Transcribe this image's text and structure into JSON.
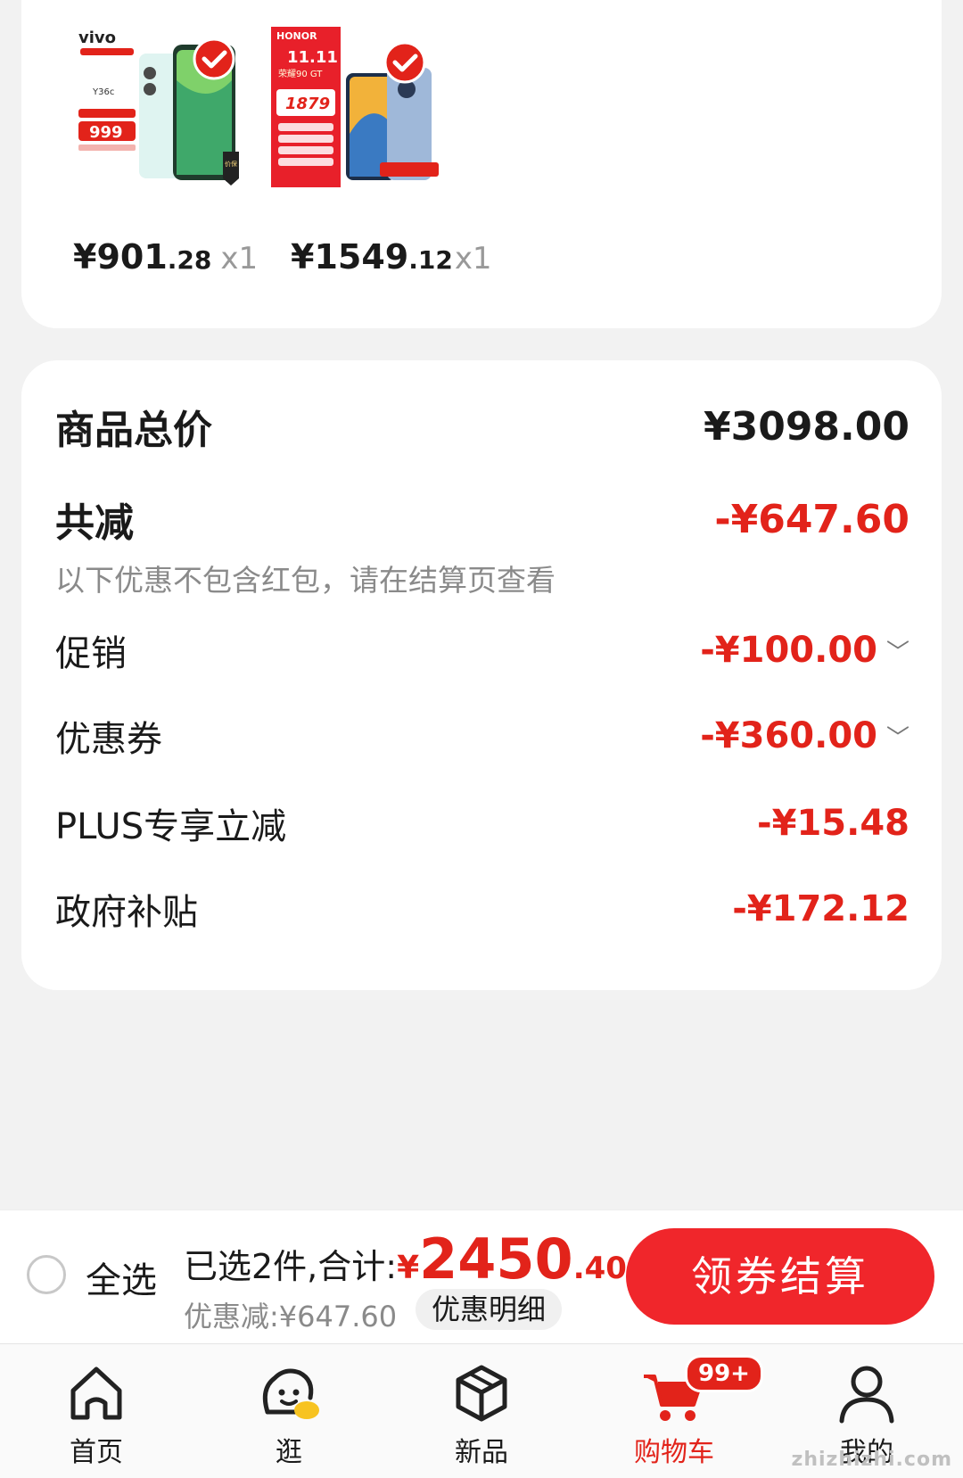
{
  "products": [
    {
      "brand": "vivo",
      "model": "Y36c",
      "promo_price": "999",
      "badge": "价保 11.11",
      "price_int": "¥901",
      "price_dec": ".28",
      "qty": "x1"
    },
    {
      "brand": "HONOR",
      "model": "荣耀90 GT",
      "event": "11.11",
      "promo_price": "1879",
      "price_int": "¥1549",
      "price_dec": ".12",
      "qty": "x1"
    }
  ],
  "summary": {
    "total_label": "商品总价",
    "total_value": "¥3098.00",
    "reduce_label": "共减",
    "reduce_value": "-¥647.60",
    "reduce_note": "以下优惠不包含红包，请在结算页查看",
    "items": [
      {
        "label": "促销",
        "value": "-¥100.00",
        "expandable": true
      },
      {
        "label": "优惠券",
        "value": "-¥360.00",
        "expandable": true
      },
      {
        "label": "PLUS专享立减",
        "value": "-¥15.48",
        "expandable": false
      },
      {
        "label": "政府补贴",
        "value": "-¥172.12",
        "expandable": false
      }
    ]
  },
  "checkout": {
    "select_all": "全选",
    "selected_text": "已选2件,合计:",
    "currency": "¥",
    "total_int": "2450",
    "total_dec": ".40",
    "discount_text": "优惠减:¥647.60",
    "detail_button": "优惠明细",
    "checkout_button": "领券结算"
  },
  "tabs": [
    {
      "label": "首页",
      "icon": "home-icon",
      "active": false
    },
    {
      "label": "逛",
      "icon": "browse-icon",
      "active": false
    },
    {
      "label": "新品",
      "icon": "new-products-icon",
      "active": false
    },
    {
      "label": "购物车",
      "icon": "cart-icon",
      "active": true,
      "badge": "99+"
    },
    {
      "label": "我的",
      "icon": "profile-icon",
      "active": false
    }
  ],
  "watermark": "zhizhizhi.com",
  "colors": {
    "accent": "#e2231a",
    "background": "#f2f2f2"
  }
}
